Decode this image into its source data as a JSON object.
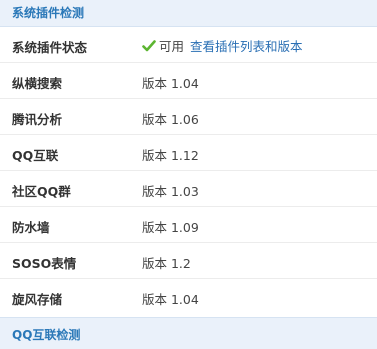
{
  "section1": {
    "title": "系统插件检测"
  },
  "status_row": {
    "label": "系统插件状态",
    "status": "可用",
    "link": "查看插件列表和版本"
  },
  "plugins": [
    {
      "name": "纵横搜索",
      "version": "版本 1.04"
    },
    {
      "name": "腾讯分析",
      "version": "版本 1.06"
    },
    {
      "name": "QQ互联",
      "version": "版本 1.12"
    },
    {
      "name": "社区QQ群",
      "version": "版本 1.03"
    },
    {
      "name": "防水墙",
      "version": "版本 1.09"
    },
    {
      "name": "SOSO表情",
      "version": "版本 1.2"
    },
    {
      "name": "旋风存储",
      "version": "版本 1.04"
    }
  ],
  "section2": {
    "title": "QQ互联检测"
  },
  "colors": {
    "header_bg": "#eaf1fa",
    "header_text": "#2a78b8",
    "link": "#2a6fb4",
    "check": "#5cb531"
  }
}
